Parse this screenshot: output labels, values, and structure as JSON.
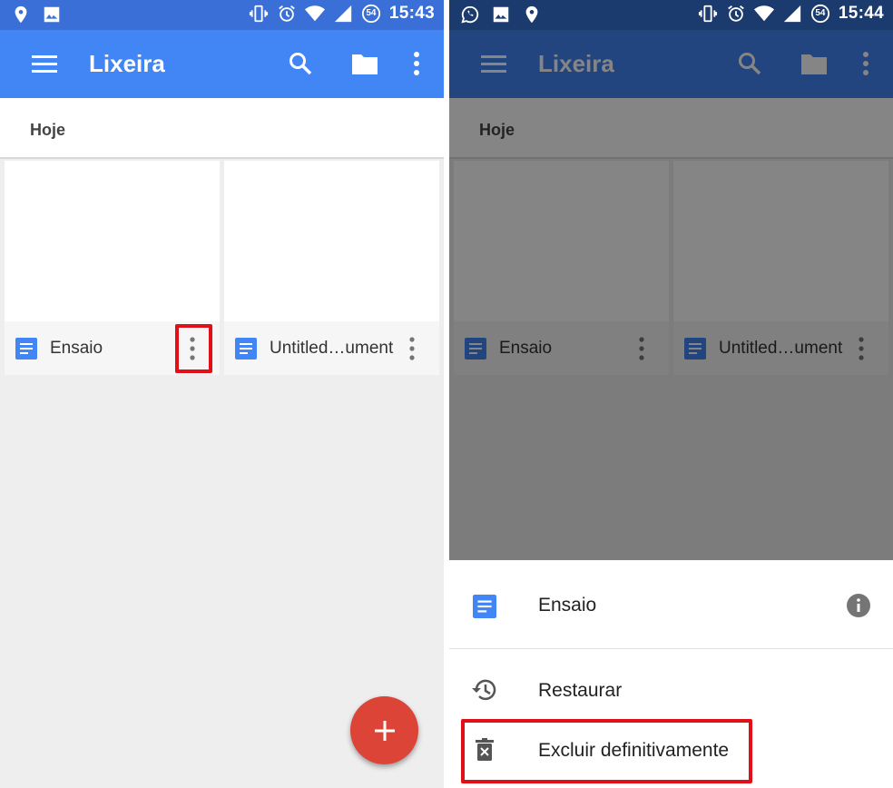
{
  "left": {
    "status": {
      "time": "15:43",
      "battery_level": "54"
    },
    "appbar": {
      "title": "Lixeira"
    },
    "section": {
      "label": "Hoje"
    },
    "files": [
      {
        "name": "Ensaio"
      },
      {
        "name": "Untitled…ument"
      }
    ]
  },
  "right": {
    "status": {
      "time": "15:44",
      "battery_level": "54"
    },
    "appbar": {
      "title": "Lixeira"
    },
    "section": {
      "label": "Hoje"
    },
    "files": [
      {
        "name": "Ensaio"
      },
      {
        "name": "Untitled…ument"
      }
    ],
    "sheet": {
      "file_name": "Ensaio",
      "actions": [
        {
          "label": "Restaurar",
          "icon": "history-icon"
        },
        {
          "label": "Excluir definitivamente",
          "icon": "delete-forever-icon"
        }
      ]
    }
  },
  "colors": {
    "status_bar": "#3a6fd8",
    "app_bar": "#4285f4",
    "doc_icon": "#4285f4",
    "fab": "#db4437",
    "highlight": "#e10f17"
  }
}
